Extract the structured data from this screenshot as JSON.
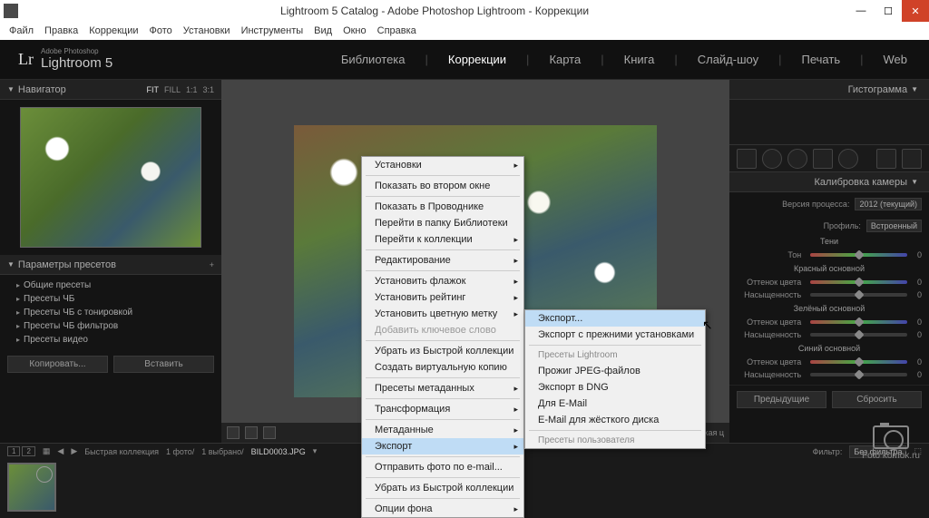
{
  "window": {
    "title": "Lightroom 5 Catalog - Adobe Photoshop Lightroom - Коррекции"
  },
  "menubar": [
    "Файл",
    "Правка",
    "Коррекции",
    "Фото",
    "Установки",
    "Инструменты",
    "Вид",
    "Окно",
    "Справка"
  ],
  "brand": {
    "sub": "Adobe Photoshop",
    "name": "Lightroom 5",
    "mark": "Lr"
  },
  "modules": {
    "items": [
      "Библиотека",
      "Коррекции",
      "Карта",
      "Книга",
      "Слайд-шоу",
      "Печать",
      "Web"
    ],
    "active": "Коррекции"
  },
  "left": {
    "navigator": {
      "title": "Навигатор",
      "modes": [
        "FIT",
        "FILL",
        "1:1",
        "3:1"
      ]
    },
    "presets": {
      "title": "Параметры пресетов",
      "items": [
        "Общие пресеты",
        "Пресеты ЧБ",
        "Пресеты ЧБ с тонировкой",
        "Пресеты ЧБ фильтров",
        "Пресеты видео"
      ]
    },
    "copy_btn": "Копировать...",
    "paste_btn": "Вставить"
  },
  "right": {
    "histogram": "Гистограмма",
    "calibration": {
      "title": "Калибровка камеры",
      "process_lbl": "Версия процесса:",
      "process_val": "2012 (текущий)",
      "profile_lbl": "Профиль:",
      "profile_val": "Встроенный",
      "shadows": "Тени",
      "tone": "Тон",
      "red": "Красный основной",
      "green": "Зелёный основной",
      "blue": "Синий основной",
      "hue": "Оттенок цвета",
      "sat": "Насыщенность",
      "zero": "0"
    },
    "prev_btn": "Предыдущие",
    "reset_btn": "Сбросить"
  },
  "toolbar": {
    "soft": "Мягкая ц"
  },
  "filmstrip": {
    "pages": [
      "1",
      "2"
    ],
    "collection": "Быстрая коллекция",
    "count": "1 фото/",
    "selected": "1 выбрано/",
    "filename": "BILD0003.JPG",
    "filter_lbl": "Фильтр:",
    "filter_val": "Без фильтра"
  },
  "ctx1": [
    {
      "t": "Установки",
      "a": true
    },
    {
      "sep": true
    },
    {
      "t": "Показать во втором окне"
    },
    {
      "sep": true
    },
    {
      "t": "Показать в Проводнике"
    },
    {
      "t": "Перейти в папку Библиотеки"
    },
    {
      "t": "Перейти к коллекции",
      "a": true
    },
    {
      "sep": true
    },
    {
      "t": "Редактирование",
      "a": true
    },
    {
      "sep": true
    },
    {
      "t": "Установить флажок",
      "a": true
    },
    {
      "t": "Установить рейтинг",
      "a": true
    },
    {
      "t": "Установить цветную метку",
      "a": true
    },
    {
      "t": "Добавить ключевое слово",
      "dis": true
    },
    {
      "sep": true
    },
    {
      "t": "Убрать из Быстрой коллекции"
    },
    {
      "t": "Создать виртуальную копию"
    },
    {
      "sep": true
    },
    {
      "t": "Пресеты метаданных",
      "a": true
    },
    {
      "sep": true
    },
    {
      "t": "Трансформация",
      "a": true
    },
    {
      "sep": true
    },
    {
      "t": "Метаданные",
      "a": true
    },
    {
      "t": "Экспорт",
      "a": true,
      "hl": true
    },
    {
      "sep": true
    },
    {
      "t": "Отправить фото по e-mail..."
    },
    {
      "sep": true
    },
    {
      "t": "Убрать из Быстрой коллекции"
    },
    {
      "sep": true
    },
    {
      "t": "Опции фона",
      "a": true
    }
  ],
  "ctx2": [
    {
      "t": "Экспорт...",
      "hl": true
    },
    {
      "t": "Экспорт с прежними установками"
    },
    {
      "sep": true
    },
    {
      "hdr": "Пресеты Lightroom"
    },
    {
      "t": "Прожиг JPEG-файлов"
    },
    {
      "t": "Экспорт в DNG"
    },
    {
      "t": "Для E-Mail"
    },
    {
      "t": "E-Mail для жёсткого диска"
    },
    {
      "sep": true
    },
    {
      "hdr": "Пресеты пользователя"
    }
  ],
  "watermark": "Foto\nkomok.ru"
}
